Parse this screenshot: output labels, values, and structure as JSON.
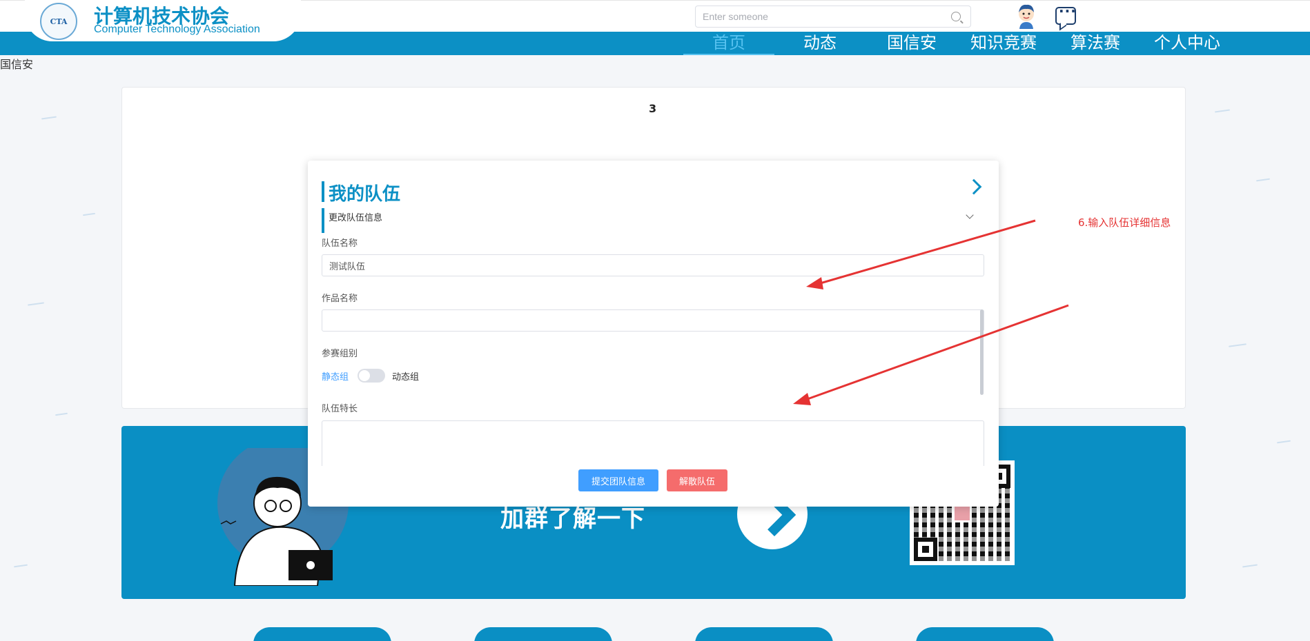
{
  "header": {
    "logo_cn": "计算机技术协会",
    "logo_en": "Computer Technology Association",
    "logo_badge": "CTA",
    "search_placeholder": "Enter someone"
  },
  "nav": {
    "items": [
      {
        "label": "首页",
        "active": true
      },
      {
        "label": "动态",
        "active": false
      },
      {
        "label": "国信安",
        "active": false
      },
      {
        "label": "知识竞赛",
        "active": false
      },
      {
        "label": "算法赛",
        "active": false
      },
      {
        "label": "个人中心",
        "active": false
      }
    ]
  },
  "page": {
    "label": "国信安",
    "card_number": "3"
  },
  "banner": {
    "text": "加群了解一下"
  },
  "modal": {
    "title": "我的队伍",
    "section": "更改队伍信息",
    "team_name_label": "队伍名称",
    "team_name_value": "测试队伍",
    "work_name_label": "作品名称",
    "work_name_value": "",
    "group_label": "参赛组别",
    "group_static": "静态组",
    "group_dynamic": "动态组",
    "specialty_label": "队伍特长",
    "submit_label": "提交团队信息",
    "dissolve_label": "解散队伍"
  },
  "annotation": {
    "text": "6.输入队伍详细信息"
  },
  "colors": {
    "brand": "#0c90c5",
    "primary": "#409eff",
    "danger": "#f56c6c",
    "annotation": "#e53333"
  }
}
